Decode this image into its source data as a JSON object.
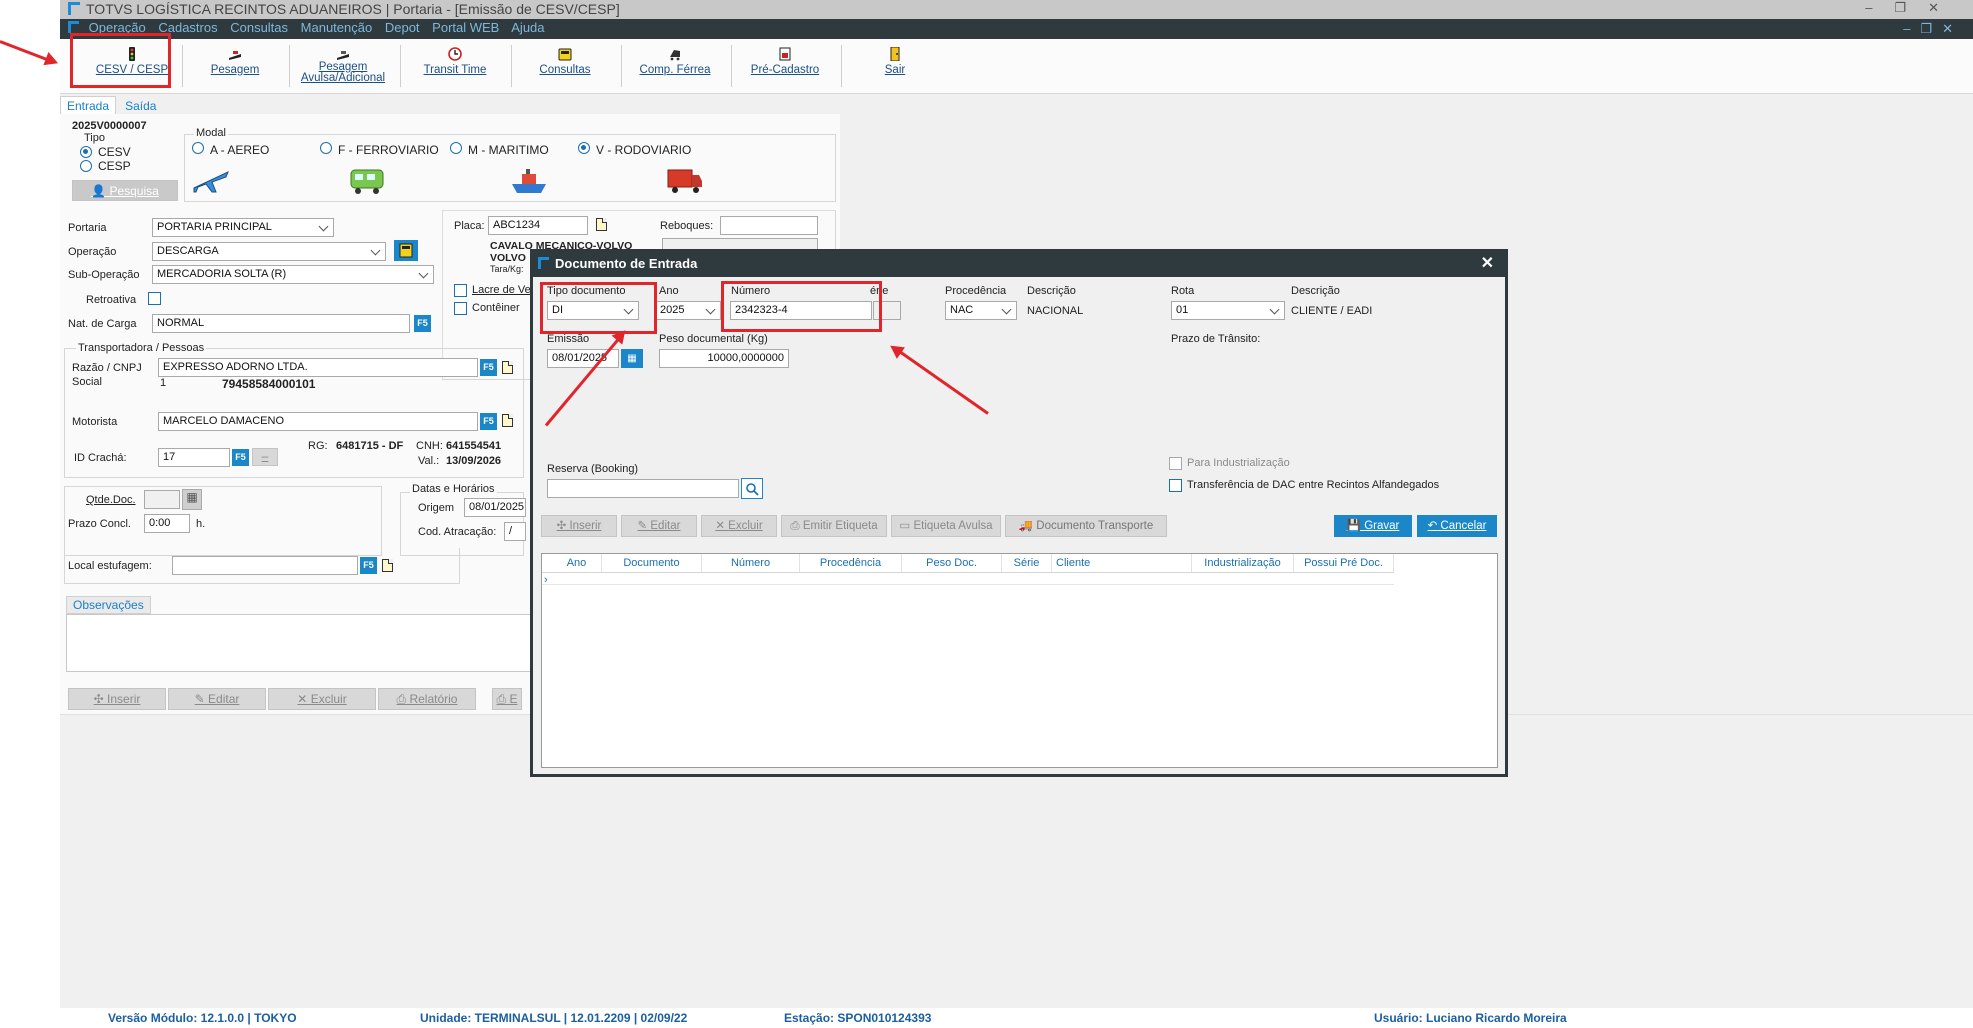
{
  "window": {
    "title": "TOTVS LOGÍSTICA RECINTOS ADUANEIROS | Portaria - [Emissão de CESV/CESP]"
  },
  "menu": [
    "Operação",
    "Cadastros",
    "Consultas",
    "Manutenção",
    "Depot",
    "Portal WEB",
    "Ajuda"
  ],
  "toolbar": {
    "cesv": "CESV / CESP",
    "pesagem": "Pesagem",
    "pesagem_avulsa_1": "Pesagem",
    "pesagem_avulsa_2": "Avulsa/Adicional",
    "transit_time": "Transit Time",
    "consultas": "Consultas",
    "comp_ferrea": "Comp. Férrea",
    "pre_cadastro": "Pré-Cadastro",
    "sair": "Sair"
  },
  "tabs": [
    "Entrada",
    "Saída"
  ],
  "main": {
    "code": "2025V0000007",
    "tipo_label": "Tipo",
    "tipo_options": [
      "CESV",
      "CESP"
    ],
    "pesquisa": "Pesquisa",
    "modal_label": "Modal",
    "modal_options": [
      "A - AEREO",
      "F - FERROVIARIO",
      "M - MARITIMO",
      "V - RODOVIARIO"
    ],
    "portaria_label": "Portaria",
    "portaria": "PORTARIA PRINCIPAL",
    "operacao_label": "Operação",
    "operacao": "DESCARGA",
    "sub_operacao_label": "Sub-Operação",
    "sub_operacao": "MERCADORIA SOLTA (R)",
    "retroativa_label": "Retroativa",
    "nat_carga_label": "Nat. de Carga",
    "nat_carga": "NORMAL",
    "placa_label": "Placa:",
    "placa": "ABC1234",
    "reboques_label": "Reboques:",
    "veiculo_1": "CAVALO MECANICO-VOLVO",
    "veiculo_2": "VOLVO",
    "tara_label": "Tara/Kg:",
    "lacre_label": "Lacre de Ve",
    "conteiner_label": "Contêiner",
    "transportadora_label": "Transportadora / Pessoas",
    "razao_label": "Razão / CNPJ",
    "social_label": "Social",
    "razao": "EXPRESSO ADORNO LTDA.",
    "social_num": "1",
    "cnpj": "79458584000101",
    "motorista_label": "Motorista",
    "motorista": "MARCELO DAMACENO",
    "id_cracha_label": "ID Crachá:",
    "id_cracha": "17",
    "rg_label": "RG:",
    "rg": "6481715 - DF",
    "cnh_label": "CNH:",
    "cnh": "641554541",
    "val_label": "Val.:",
    "val": "13/09/2026",
    "qtde_doc_label": "Qtde.Doc.",
    "prazo_label": "Prazo Concl.",
    "prazo": "0:00",
    "prazo_unit": "h.",
    "datas_label": "Datas e Horários",
    "origem_label": "Origem",
    "origem": "08/01/2025",
    "cod_atracacao_label": "Cod. Atracação:",
    "cod_atracacao": "/",
    "local_estufagem_label": "Local estufagem:",
    "observacoes_label": "Observações",
    "btn_inserir": "Inserir",
    "btn_editar": "Editar",
    "btn_excluir": "Excluir",
    "btn_relatorio": "Relatório",
    "btn_more": "E"
  },
  "dialog": {
    "title": "Documento de Entrada",
    "tipo_documento_label": "Tipo documento",
    "tipo_documento": "DI",
    "ano_label": "Ano",
    "ano": "2025",
    "numero_label": "Número",
    "numero": "2342323-4",
    "serie_label": "érie",
    "procedencia_label": "Procedência",
    "procedencia": "NAC",
    "descricao_label": "Descrição",
    "descricao": "NACIONAL",
    "rota_label": "Rota",
    "rota": "01",
    "descricao2_label": "Descrição",
    "descricao2": "CLIENTE / EADI",
    "emissao_label": "Emissão",
    "emissao": "08/01/2025",
    "peso_label": "Peso documental (Kg)",
    "peso": "10000,0000000",
    "prazo_transito_label": "Prazo de Trânsito:",
    "reserva_label": "Reserva (Booking)",
    "para_industrializacao": "Para Industrialização",
    "transferencia_dac": "Transferência de DAC entre Recintos Alfandegados",
    "btn_inserir": "Inserir",
    "btn_editar": "Editar",
    "btn_excluir": "Excluir",
    "btn_emitir_etiqueta": "Emitir Etiqueta",
    "btn_etiqueta_avulsa": "Etiqueta Avulsa",
    "btn_documento_transporte": "Documento Transporte",
    "btn_gravar": "Gravar",
    "btn_cancelar": "Cancelar",
    "grid_columns": [
      "Ano",
      "Documento",
      "Número",
      "Procedência",
      "Peso Doc.",
      "Série",
      "Cliente",
      "Industrialização",
      "Possui Pré Doc."
    ]
  },
  "status": {
    "versao": "Versão Módulo:  12.1.0.0  |  TOKYO",
    "unidade": "Unidade: TERMINALSUL | 12.01.2209 | 02/09/22",
    "estacao": "Estação: SPON010124393",
    "usuario": "Usuário: Luciano Ricardo Moreira"
  },
  "colors": {
    "accent": "#1b87c9",
    "annotation": "#e0262b",
    "titlebar_dark": "#2f3a3e"
  }
}
